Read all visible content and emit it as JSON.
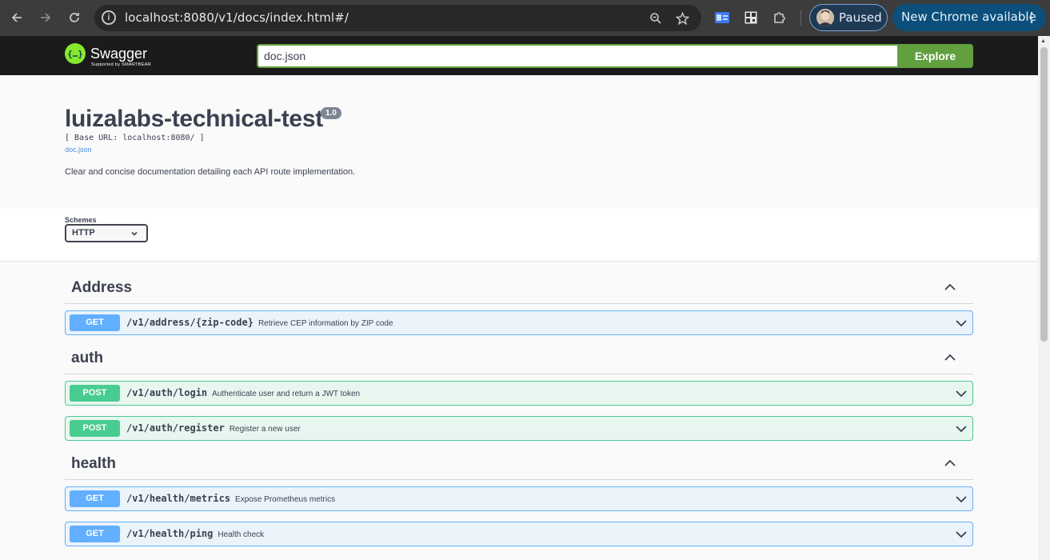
{
  "browser": {
    "url": "localhost:8080/v1/docs/index.html#/",
    "profile_status": "Paused",
    "update_label": "New Chrome available"
  },
  "swagger_bar": {
    "logo_name": "Swagger",
    "logo_sub": "Supported by SMARTBEAR",
    "spec_url": "doc.json",
    "explore_label": "Explore"
  },
  "info": {
    "title": "luizalabs-technical-test",
    "version": "1.0",
    "base_url": "[ Base URL: localhost:8080/ ]",
    "doc_link": "doc.json",
    "description": "Clear and concise documentation detailing each API route implementation."
  },
  "schemes": {
    "label": "Schemes",
    "selected": "HTTP"
  },
  "tags": [
    {
      "name": "Address",
      "operations": [
        {
          "method": "GET",
          "path": "/v1/address/{zip-code}",
          "summary": "Retrieve CEP information by ZIP code"
        }
      ]
    },
    {
      "name": "auth",
      "operations": [
        {
          "method": "POST",
          "path": "/v1/auth/login",
          "summary": "Authenticate user and return a JWT token"
        },
        {
          "method": "POST",
          "path": "/v1/auth/register",
          "summary": "Register a new user"
        }
      ]
    },
    {
      "name": "health",
      "operations": [
        {
          "method": "GET",
          "path": "/v1/health/metrics",
          "summary": "Expose Prometheus metrics"
        },
        {
          "method": "GET",
          "path": "/v1/health/ping",
          "summary": "Health check"
        }
      ]
    }
  ],
  "colors": {
    "get": "#61affe",
    "post": "#49cc90",
    "explore": "#62a03f"
  }
}
